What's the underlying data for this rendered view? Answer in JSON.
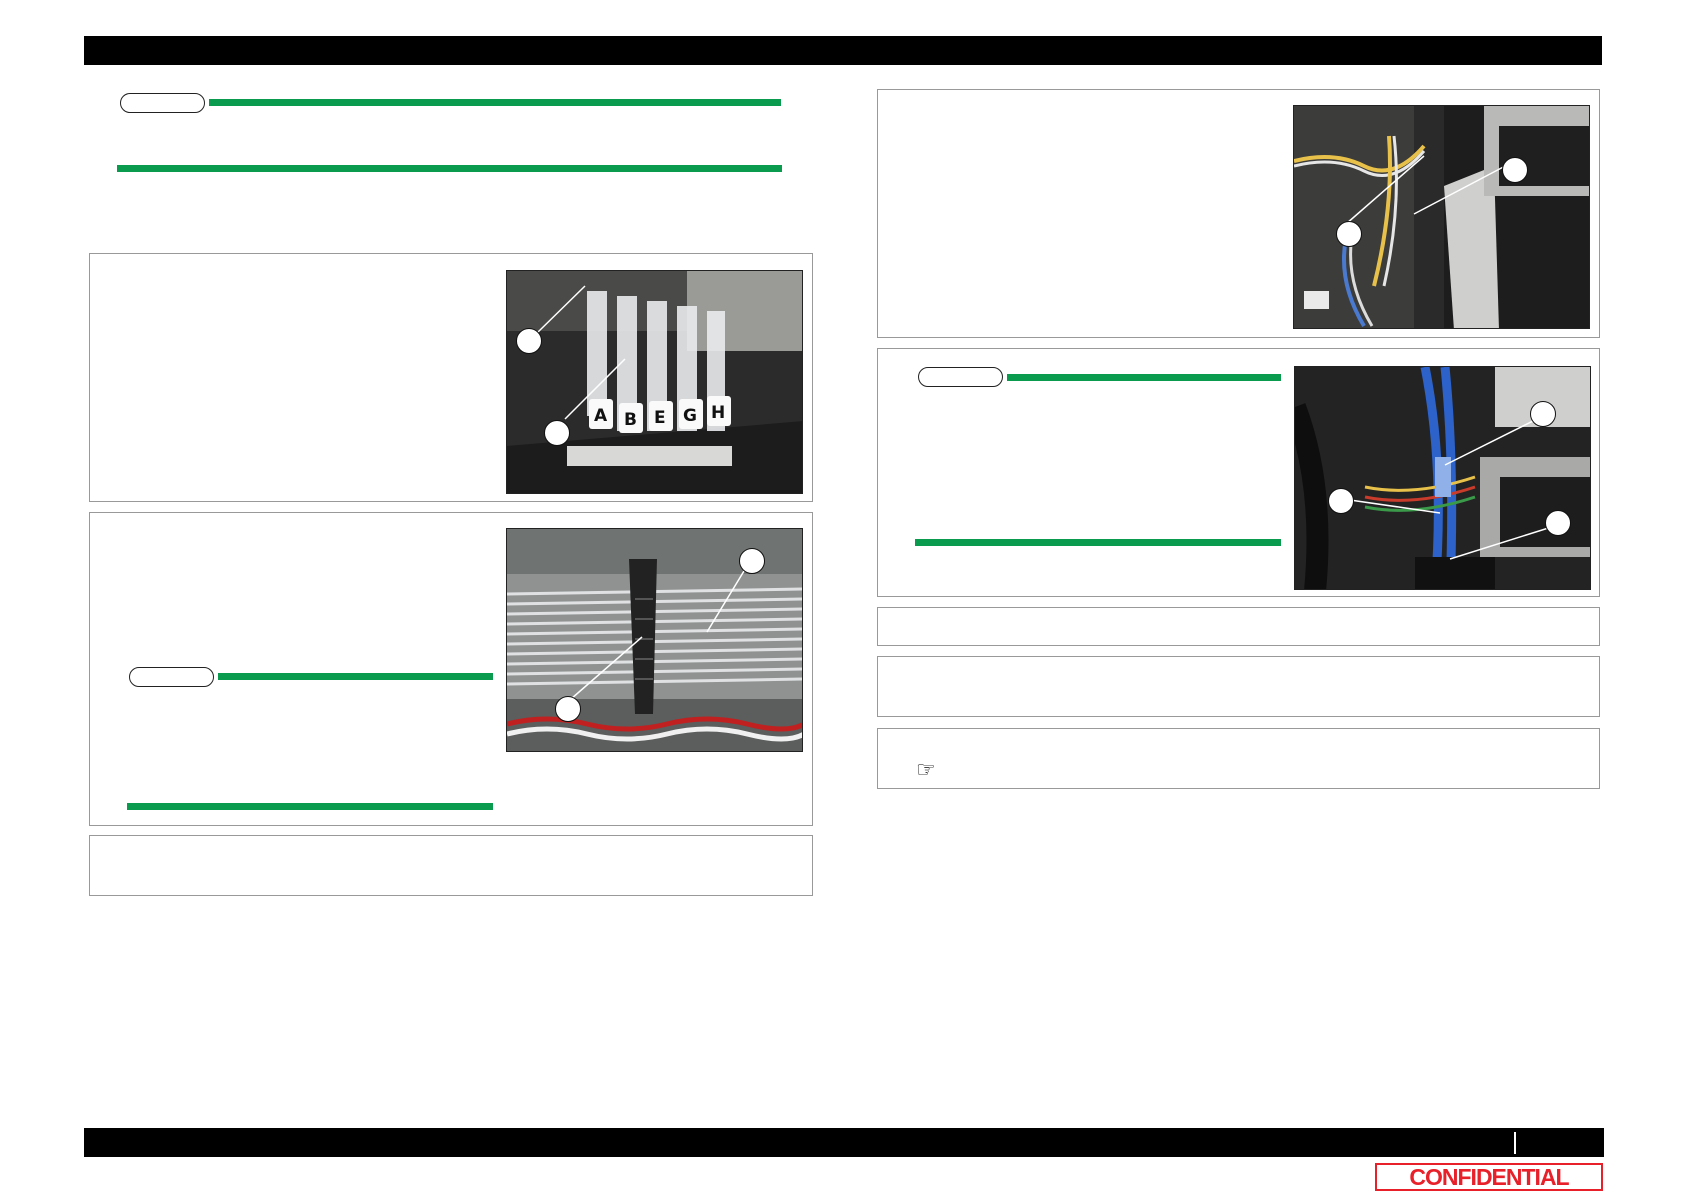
{
  "footer": {
    "confidential_stamp": "CONFIDENTIAL"
  },
  "icons": {
    "reference": "pointing-hand-icon"
  },
  "photos": {
    "ink_tubes": {
      "labels": [
        "A",
        "B",
        "E",
        "G",
        "H"
      ]
    }
  },
  "colors": {
    "note_line": "#0a9b4f",
    "header_bar": "#000000",
    "stamp": "#e8202a"
  }
}
